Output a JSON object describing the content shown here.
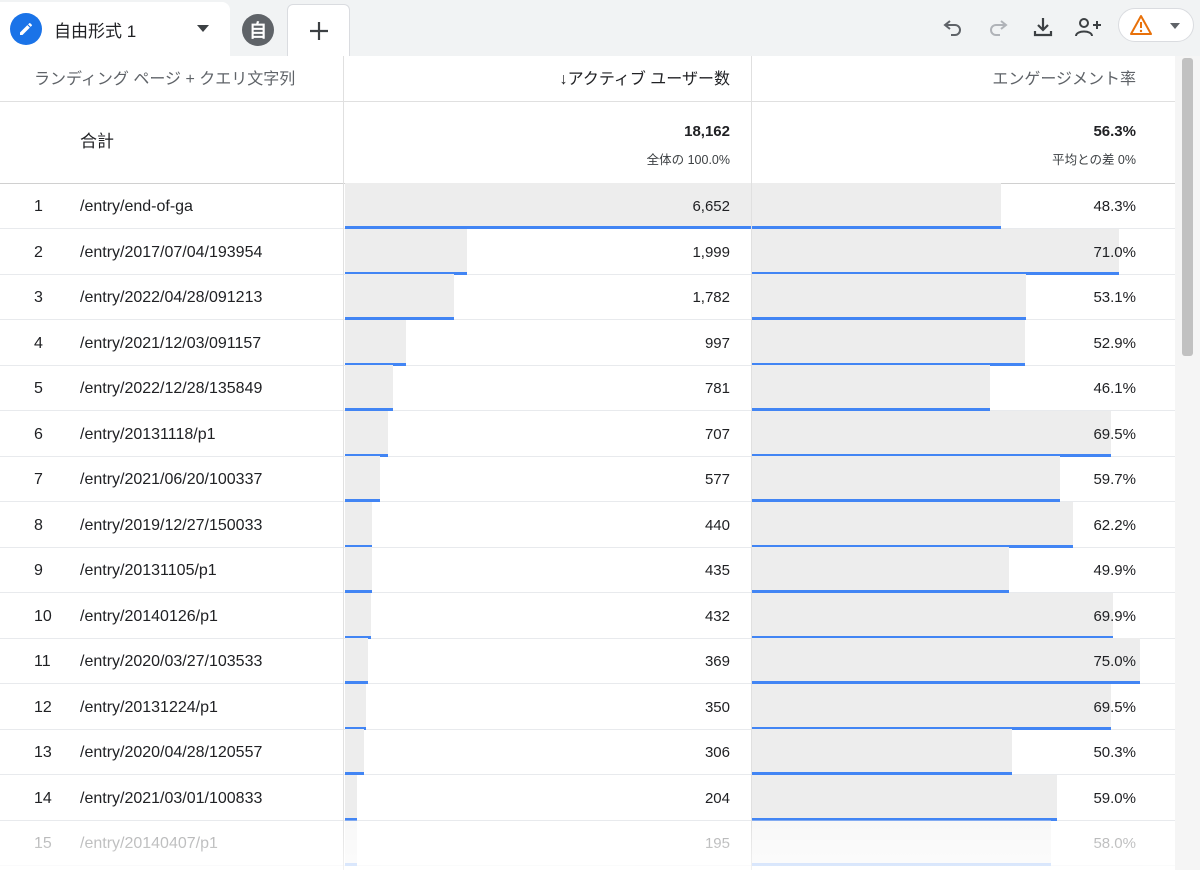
{
  "tabs": {
    "active_title": "自由形式 1",
    "self_label": "自"
  },
  "toolbar": {
    "icons": [
      "undo-icon",
      "redo-icon",
      "download-icon",
      "share-user-icon",
      "warning-icon"
    ],
    "accent": "#1a73e8",
    "warning_color": "#e8710a"
  },
  "table": {
    "headers": {
      "dimension": "ランディング ページ + クエリ文字列",
      "metric1": "↓アクティブ ユーザー数",
      "metric2": "エンゲージメント率"
    },
    "totals": {
      "label": "合計",
      "metric1_value": "18,162",
      "metric1_sub": "全体の 100.0%",
      "metric2_value": "56.3%",
      "metric2_sub": "平均との差 0%"
    },
    "rows": [
      {
        "num": "1",
        "path": "/entry/end-of-ga",
        "users": "6,652",
        "users_n": 6652,
        "rate": "48.3%",
        "rate_n": 48.3
      },
      {
        "num": "2",
        "path": "/entry/2017/07/04/193954",
        "users": "1,999",
        "users_n": 1999,
        "rate": "71.0%",
        "rate_n": 71.0
      },
      {
        "num": "3",
        "path": "/entry/2022/04/28/091213",
        "users": "1,782",
        "users_n": 1782,
        "rate": "53.1%",
        "rate_n": 53.1
      },
      {
        "num": "4",
        "path": "/entry/2021/12/03/091157",
        "users": "997",
        "users_n": 997,
        "rate": "52.9%",
        "rate_n": 52.9
      },
      {
        "num": "5",
        "path": "/entry/2022/12/28/135849",
        "users": "781",
        "users_n": 781,
        "rate": "46.1%",
        "rate_n": 46.1
      },
      {
        "num": "6",
        "path": "/entry/20131118/p1",
        "users": "707",
        "users_n": 707,
        "rate": "69.5%",
        "rate_n": 69.5
      },
      {
        "num": "7",
        "path": "/entry/2021/06/20/100337",
        "users": "577",
        "users_n": 577,
        "rate": "59.7%",
        "rate_n": 59.7
      },
      {
        "num": "8",
        "path": "/entry/2019/12/27/150033",
        "users": "440",
        "users_n": 440,
        "rate": "62.2%",
        "rate_n": 62.2
      },
      {
        "num": "9",
        "path": "/entry/20131105/p1",
        "users": "435",
        "users_n": 435,
        "rate": "49.9%",
        "rate_n": 49.9
      },
      {
        "num": "10",
        "path": "/entry/20140126/p1",
        "users": "432",
        "users_n": 432,
        "rate": "69.9%",
        "rate_n": 69.9
      },
      {
        "num": "11",
        "path": "/entry/2020/03/27/103533",
        "users": "369",
        "users_n": 369,
        "rate": "75.0%",
        "rate_n": 75.0
      },
      {
        "num": "12",
        "path": "/entry/20131224/p1",
        "users": "350",
        "users_n": 350,
        "rate": "69.5%",
        "rate_n": 69.5
      },
      {
        "num": "13",
        "path": "/entry/2020/04/28/120557",
        "users": "306",
        "users_n": 306,
        "rate": "50.3%",
        "rate_n": 50.3
      },
      {
        "num": "14",
        "path": "/entry/2021/03/01/100833",
        "users": "204",
        "users_n": 204,
        "rate": "59.0%",
        "rate_n": 59.0
      },
      {
        "num": "15",
        "path": "/entry/20140407/p1",
        "users": "195",
        "users_n": 195,
        "rate": "58.0%",
        "rate_n": 58.0
      }
    ]
  }
}
